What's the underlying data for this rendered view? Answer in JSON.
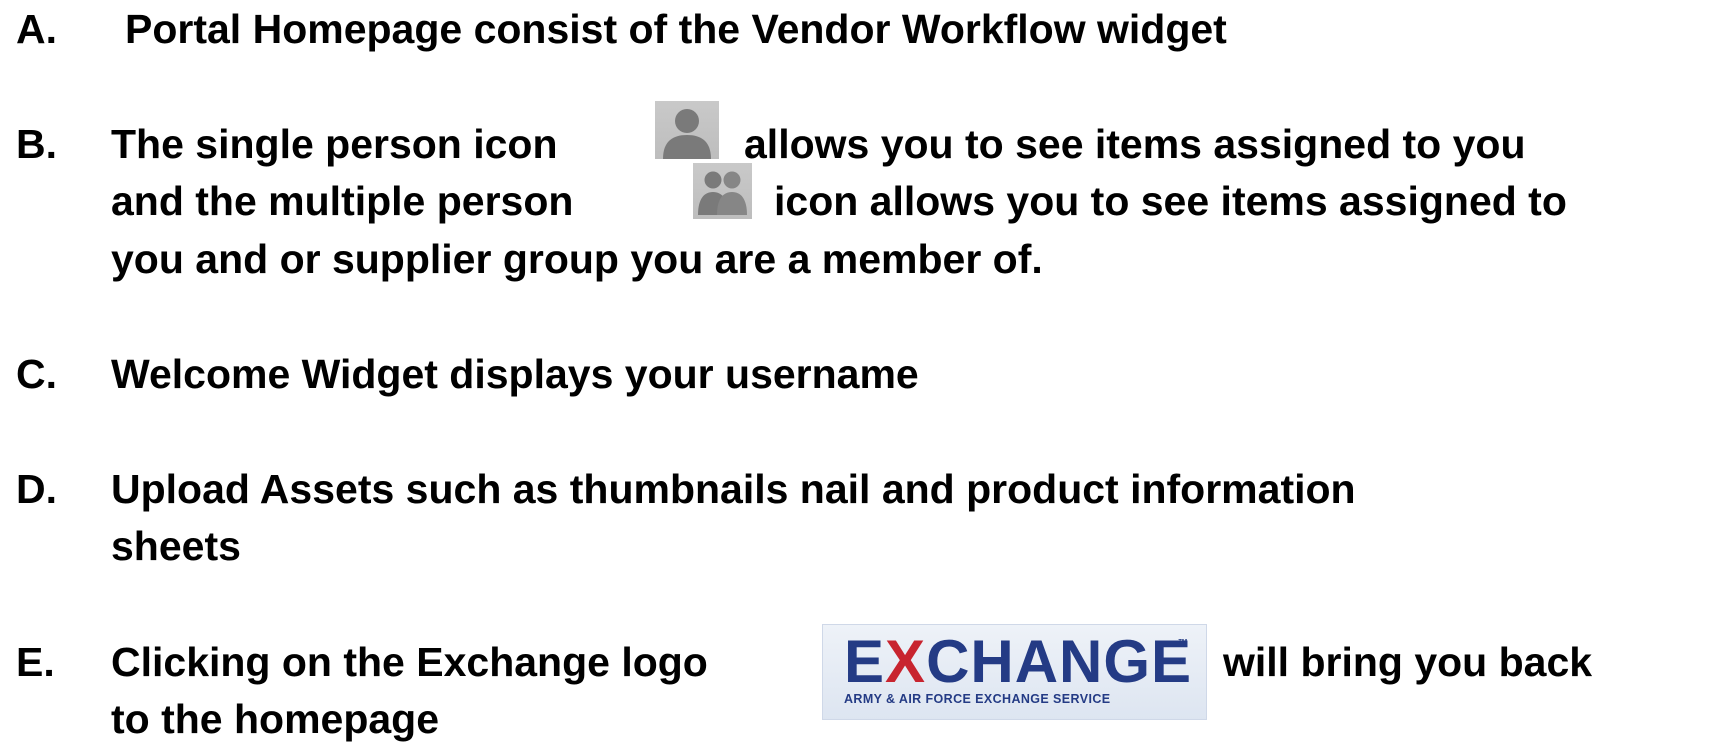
{
  "items": [
    {
      "letter": "A.",
      "lines": [
        "Portal Homepage consist of the Vendor Workflow widget"
      ]
    },
    {
      "letter": "B.",
      "line1_before": "The single person icon",
      "line1_after": "allows you to see items assigned to you",
      "line2_before": "and the multiple person",
      "line2_after": "icon allows you to see items assigned to",
      "line3": "you and or supplier group you are a member of."
    },
    {
      "letter": "C.",
      "lines": [
        "Welcome Widget displays your username"
      ]
    },
    {
      "letter": "D.",
      "lines": [
        "Upload Assets such as thumbnails nail and product information",
        "sheets"
      ]
    },
    {
      "letter": "E.",
      "line1_before": "Clicking on the Exchange logo",
      "line1_after": "will bring you back",
      "line2": "to the homepage"
    }
  ],
  "icons": {
    "single_person": "single-person-icon",
    "multiple_person": "multiple-person-icon"
  },
  "logo": {
    "word_prefix": "E",
    "word_x": "X",
    "word_suffix": "CHANGE",
    "trademark": "™",
    "subtitle": "ARMY & AIR FORCE EXCHANGE SERVICE",
    "colors": {
      "primary": "#243b85",
      "accent": "#c8242f"
    }
  }
}
